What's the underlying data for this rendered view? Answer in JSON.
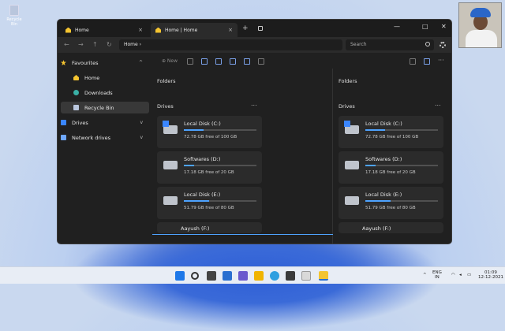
{
  "desktop": {
    "icon_label": "Recycle Bin"
  },
  "window": {
    "tabs": [
      {
        "label": "Home",
        "close": "×"
      },
      {
        "label": "Home | Home",
        "close": "×"
      }
    ],
    "new_tab": "+",
    "controls": {
      "minimize": "—",
      "maximize": "□",
      "close": "✕"
    },
    "nav": {
      "back": "←",
      "forward": "→",
      "up": "↑",
      "refresh": "↻"
    },
    "address": "Home  ›",
    "search_placeholder": "Search",
    "toolbar": {
      "new_label": "⊕  New"
    },
    "sidebar": {
      "items": [
        {
          "label": "Favourites",
          "chevron": "^"
        },
        {
          "label": "Home"
        },
        {
          "label": "Downloads"
        },
        {
          "label": "Recycle Bin"
        },
        {
          "label": "Drives",
          "chevron": "v"
        },
        {
          "label": "Network drives",
          "chevron": "v"
        }
      ]
    },
    "panes": [
      {
        "folders_heading": "Folders",
        "drives_heading": "Drives",
        "more": "...",
        "drives": [
          {
            "name": "Local Disk (C:)",
            "free": "72.78 GB free of 100 GB",
            "used_fraction": 0.27
          },
          {
            "name": "Softwares (D:)",
            "free": "17.18 GB free of 20 GB",
            "used_fraction": 0.14
          },
          {
            "name": "Local Disk (E:)",
            "free": "51.79 GB free of 80 GB",
            "used_fraction": 0.35
          },
          {
            "name": "Aayush (F:)"
          }
        ]
      },
      {
        "folders_heading": "Folders",
        "drives_heading": "Drives",
        "more": "...",
        "drives": [
          {
            "name": "Local Disk (C:)",
            "free": "72.78 GB free of 100 GB",
            "used_fraction": 0.27
          },
          {
            "name": "Softwares (D:)",
            "free": "17.18 GB free of 20 GB",
            "used_fraction": 0.14
          },
          {
            "name": "Local Disk (E:)",
            "free": "51.79 GB free of 80 GB",
            "used_fraction": 0.35
          },
          {
            "name": "Aayush (F:)"
          }
        ]
      }
    ]
  },
  "taskbar": {
    "lang": "ENG",
    "region": "IN",
    "time": "01:09",
    "date": "12-12-2021",
    "chevron": "^"
  }
}
